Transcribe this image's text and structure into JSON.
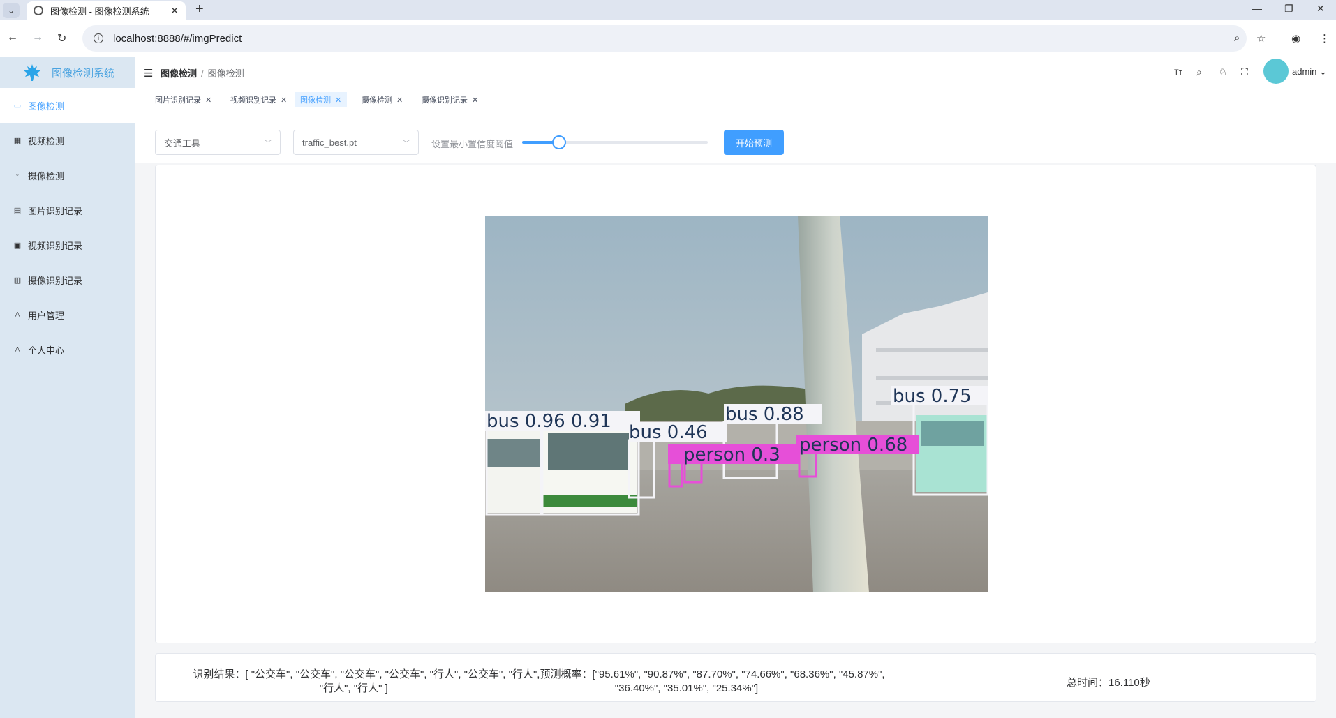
{
  "browser": {
    "tab_title": "图像检测 - 图像检测系统",
    "url": "localhost:8888/#/imgPredict"
  },
  "sidebar": {
    "logo_text": "图像检测系统",
    "items": [
      {
        "label": "图像检测",
        "icon": "image-icon"
      },
      {
        "label": "视频检测",
        "icon": "video-icon"
      },
      {
        "label": "摄像检测",
        "icon": "camera-icon"
      },
      {
        "label": "图片识别记录",
        "icon": "picture-record-icon"
      },
      {
        "label": "视频识别记录",
        "icon": "video-record-icon"
      },
      {
        "label": "摄像识别记录",
        "icon": "camera-record-icon"
      },
      {
        "label": "用户管理",
        "icon": "user-icon"
      },
      {
        "label": "个人中心",
        "icon": "person-icon"
      }
    ]
  },
  "header": {
    "breadcrumb": [
      "图像检测",
      "图像检测"
    ],
    "username": "admin"
  },
  "tags": [
    {
      "label": "图片识别记录",
      "active": false
    },
    {
      "label": "视频识别记录",
      "active": false
    },
    {
      "label": "图像检测",
      "active": true
    },
    {
      "label": "摄像检测",
      "active": false
    },
    {
      "label": "摄像识别记录",
      "active": false
    }
  ],
  "toolbar": {
    "category_select": "交通工具",
    "model_select": "traffic_best.pt",
    "confidence_label": "设置最小置信度阈值",
    "confidence_value": 0.2,
    "start_button": "开始预测"
  },
  "detections": [
    {
      "label": "bus 0.96 0.91"
    },
    {
      "label": "bus 0.46"
    },
    {
      "label": "bus 0.88"
    },
    {
      "label": "bus 0.75"
    },
    {
      "label": "person 0.3"
    },
    {
      "label": "person 0.68"
    }
  ],
  "result": {
    "line1": "识别结果：[ \"公交车\", \"公交车\", \"公交车\", \"公交车\", \"行人\", \"公交车\", \"行人\",预测概率：[\"95.61%\", \"90.87%\", \"87.70%\", \"74.66%\", \"68.36%\", \"45.87%\",",
    "line2": "\"行人\", \"行人\" ]                                                                              \"36.40%\", \"35.01%\", \"25.34%\"]",
    "total_time": "总时间：16.110秒"
  }
}
